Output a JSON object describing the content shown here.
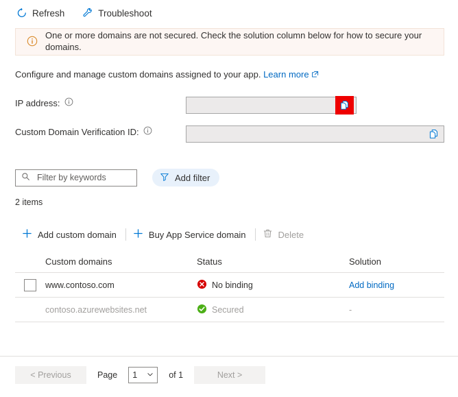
{
  "toolbar": {
    "refresh_label": "Refresh",
    "troubleshoot_label": "Troubleshoot"
  },
  "banner": {
    "message": "One or more domains are not secured. Check the solution column below for how to secure your domains.",
    "icon": "info-circle-icon",
    "background": "#fdf6f3",
    "icon_color": "#d98b2b"
  },
  "description": {
    "text": "Configure and manage custom domains assigned to your app.",
    "link_label": "Learn more"
  },
  "fields": {
    "ip": {
      "label": "IP address:",
      "value": "",
      "copy_label": "copy-icon",
      "highlighted": true,
      "highlight_color": "#ee0000"
    },
    "verification_id": {
      "label": "Custom Domain Verification ID:",
      "value": "",
      "copy_label": "copy-icon",
      "highlighted": false
    }
  },
  "filters": {
    "search_placeholder": "Filter by keywords",
    "search_value": "",
    "add_filter_label": "Add filter"
  },
  "items_count": "2 items",
  "commands": {
    "add_custom_domain": "Add custom domain",
    "buy_app_service_domain": "Buy App Service domain",
    "delete": "Delete"
  },
  "table": {
    "headers": {
      "domains": "Custom domains",
      "status": "Status",
      "solution": "Solution"
    },
    "rows": [
      {
        "domain": "www.contoso.com",
        "status": "No binding",
        "status_icon": "error-circle-icon",
        "status_color": "#d60000",
        "solution": "Add binding",
        "solution_is_link": true,
        "selectable": true,
        "muted": false
      },
      {
        "domain": "contoso.azurewebsites.net",
        "status": "Secured",
        "status_icon": "success-circle-icon",
        "status_color": "#4caf17",
        "solution": "-",
        "solution_is_link": false,
        "selectable": false,
        "muted": true
      }
    ]
  },
  "pagination": {
    "previous_label": "< Previous",
    "page_label": "Page",
    "page_value": "1",
    "of_label": "of 1",
    "next_label": "Next >"
  },
  "colors": {
    "link": "#0069c2",
    "accent": "#0078d4"
  }
}
